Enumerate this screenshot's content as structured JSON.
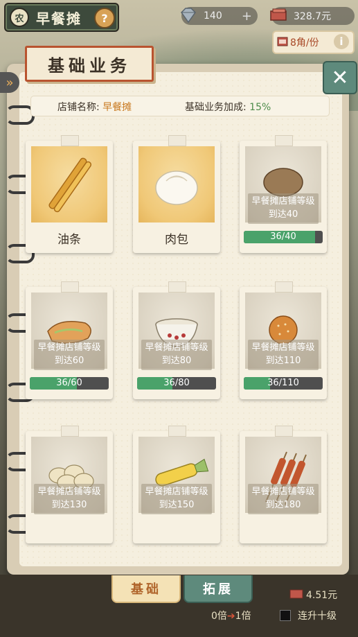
{
  "header": {
    "shop_badge": "农",
    "shop_title": "早餐摊",
    "help": "?",
    "gems": "140",
    "gems_plus": "+",
    "cash": "328.7元",
    "price": "8角/份",
    "price_info": "i"
  },
  "panel": {
    "title": "基础业务",
    "close": "✕",
    "side_tab": "»",
    "info_label_1": "店铺名称: ",
    "info_value_1": "早餐摊",
    "info_label_2": "基础业务加成: ",
    "info_value_2": "15%"
  },
  "items": [
    {
      "name": "油条",
      "unlocked": true,
      "icon": "youtiao-icon"
    },
    {
      "name": "肉包",
      "unlocked": true,
      "icon": "baozi-icon"
    },
    {
      "lock_line1": "早餐摊店铺等级",
      "lock_line2": "到达40",
      "progress": "36/40",
      "fraction": 0.9,
      "icon": "potato-bread-icon"
    },
    {
      "lock_line1": "早餐摊店铺等级",
      "lock_line2": "到达60",
      "progress": "36/60",
      "fraction": 0.6,
      "icon": "pancake-icon"
    },
    {
      "lock_line1": "早餐摊店铺等级",
      "lock_line2": "到达80",
      "progress": "36/80",
      "fraction": 0.45,
      "icon": "porridge-bowl-icon"
    },
    {
      "lock_line1": "早餐摊店铺等级",
      "lock_line2": "到达110",
      "progress": "36/110",
      "fraction": 0.33,
      "icon": "sesame-ball-icon"
    },
    {
      "lock_line1": "早餐摊店铺等级",
      "lock_line2": "到达130",
      "icon": "dumplings-icon"
    },
    {
      "lock_line1": "早餐摊店铺等级",
      "lock_line2": "到达150",
      "icon": "corn-icon"
    },
    {
      "lock_line1": "早餐摊店铺等级",
      "lock_line2": "到达180",
      "icon": "skewers-icon"
    }
  ],
  "tabs": {
    "basic": "基础",
    "expand": "拓展"
  },
  "footer": {
    "price": "4.51元",
    "mult_from": "0倍",
    "mult_to": "1倍",
    "upgrade_ten": "连升十级"
  },
  "colors": {
    "accent_red": "#b9532f",
    "progress_green": "#4aa26a",
    "close_teal": "#5e8a7c"
  }
}
